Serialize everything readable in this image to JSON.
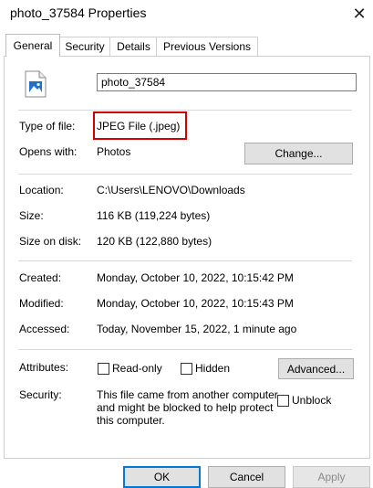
{
  "window": {
    "title": "photo_37584 Properties",
    "close": "✕"
  },
  "tabs": [
    {
      "label": "General",
      "active": true
    },
    {
      "label": "Security",
      "active": false
    },
    {
      "label": "Details",
      "active": false
    },
    {
      "label": "Previous Versions",
      "active": false
    }
  ],
  "file": {
    "icon": "image-file-icon",
    "name": "photo_37584"
  },
  "fields": {
    "type_label": "Type of file:",
    "type_value": "JPEG File (.jpeg)",
    "opens_label": "Opens with:",
    "opens_value": "Photos",
    "change_button": "Change...",
    "location_label": "Location:",
    "location_value": "C:\\Users\\LENOVO\\Downloads",
    "size_label": "Size:",
    "size_value": "116 KB (119,224 bytes)",
    "size_disk_label": "Size on disk:",
    "size_disk_value": "120 KB (122,880 bytes)",
    "created_label": "Created:",
    "created_value": "Monday, October 10, 2022, 10:15:42 PM",
    "modified_label": "Modified:",
    "modified_value": "Monday, October 10, 2022, 10:15:43 PM",
    "accessed_label": "Accessed:",
    "accessed_value": "Today, November 15, 2022, 1 minute ago",
    "attributes_label": "Attributes:",
    "readonly_label": "Read-only",
    "hidden_label": "Hidden",
    "advanced_button": "Advanced...",
    "security_label": "Security:",
    "security_line1": "This file came from another computer",
    "security_line2": "and might be blocked to help protect",
    "security_line3": "this computer.",
    "unblock_label": "Unblock"
  },
  "buttons": {
    "ok": "OK",
    "cancel": "Cancel",
    "apply": "Apply"
  },
  "colors": {
    "highlight": "#d40000",
    "focus": "#0078d7"
  }
}
